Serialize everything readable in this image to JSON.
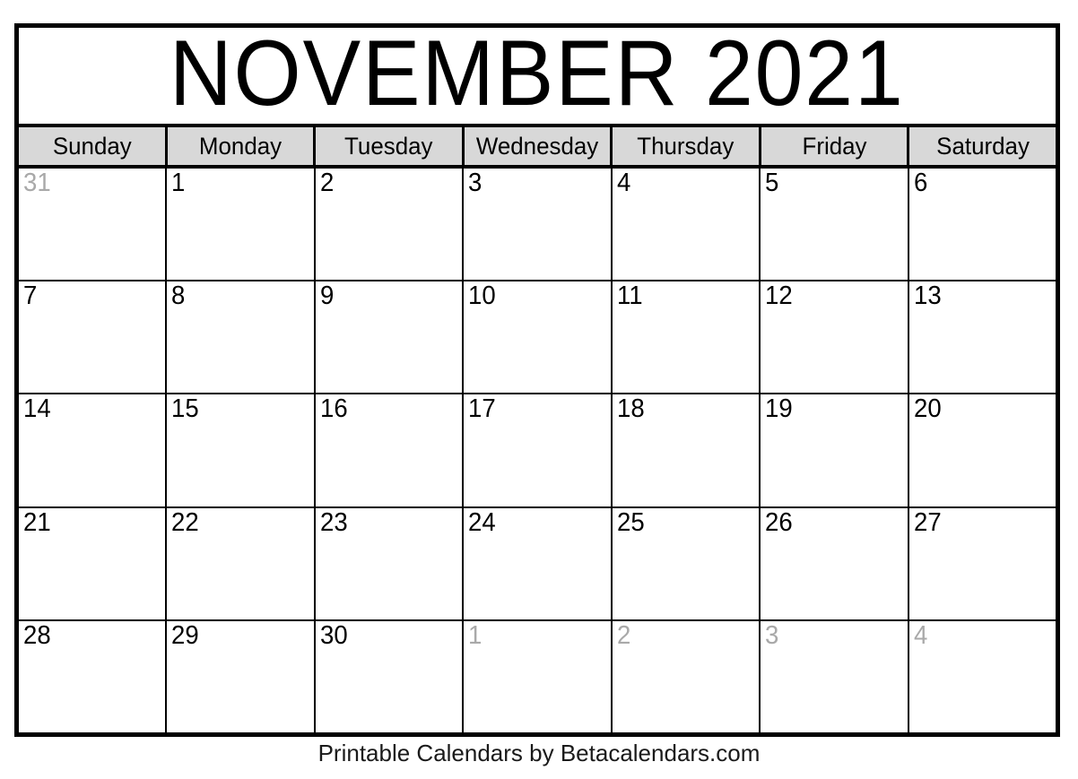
{
  "document": {
    "type": "printable-monthly-calendar",
    "month": "NOVEMBER",
    "year": "2021",
    "title": "NOVEMBER 2021"
  },
  "colors": {
    "header_background": "#d8d8d8",
    "grid_line": "#000000",
    "page_background": "#ffffff",
    "in_month_text": "#000000",
    "out_of_month_text": "#a9a9a9"
  },
  "weekdays": [
    {
      "label": "Sunday"
    },
    {
      "label": "Monday"
    },
    {
      "label": "Tuesday"
    },
    {
      "label": "Wednesday"
    },
    {
      "label": "Thursday"
    },
    {
      "label": "Friday"
    },
    {
      "label": "Saturday"
    }
  ],
  "weeks": [
    [
      {
        "day": "31",
        "in_month": false
      },
      {
        "day": "1",
        "in_month": true
      },
      {
        "day": "2",
        "in_month": true
      },
      {
        "day": "3",
        "in_month": true
      },
      {
        "day": "4",
        "in_month": true
      },
      {
        "day": "5",
        "in_month": true
      },
      {
        "day": "6",
        "in_month": true
      }
    ],
    [
      {
        "day": "7",
        "in_month": true
      },
      {
        "day": "8",
        "in_month": true
      },
      {
        "day": "9",
        "in_month": true
      },
      {
        "day": "10",
        "in_month": true
      },
      {
        "day": "11",
        "in_month": true
      },
      {
        "day": "12",
        "in_month": true
      },
      {
        "day": "13",
        "in_month": true
      }
    ],
    [
      {
        "day": "14",
        "in_month": true
      },
      {
        "day": "15",
        "in_month": true
      },
      {
        "day": "16",
        "in_month": true
      },
      {
        "day": "17",
        "in_month": true
      },
      {
        "day": "18",
        "in_month": true
      },
      {
        "day": "19",
        "in_month": true
      },
      {
        "day": "20",
        "in_month": true
      }
    ],
    [
      {
        "day": "21",
        "in_month": true
      },
      {
        "day": "22",
        "in_month": true
      },
      {
        "day": "23",
        "in_month": true
      },
      {
        "day": "24",
        "in_month": true
      },
      {
        "day": "25",
        "in_month": true
      },
      {
        "day": "26",
        "in_month": true
      },
      {
        "day": "27",
        "in_month": true
      }
    ],
    [
      {
        "day": "28",
        "in_month": true
      },
      {
        "day": "29",
        "in_month": true
      },
      {
        "day": "30",
        "in_month": true
      },
      {
        "day": "1",
        "in_month": false
      },
      {
        "day": "2",
        "in_month": false
      },
      {
        "day": "3",
        "in_month": false
      },
      {
        "day": "4",
        "in_month": false
      }
    ]
  ],
  "footer": {
    "credit": "Printable Calendars by Betacalendars.com"
  }
}
